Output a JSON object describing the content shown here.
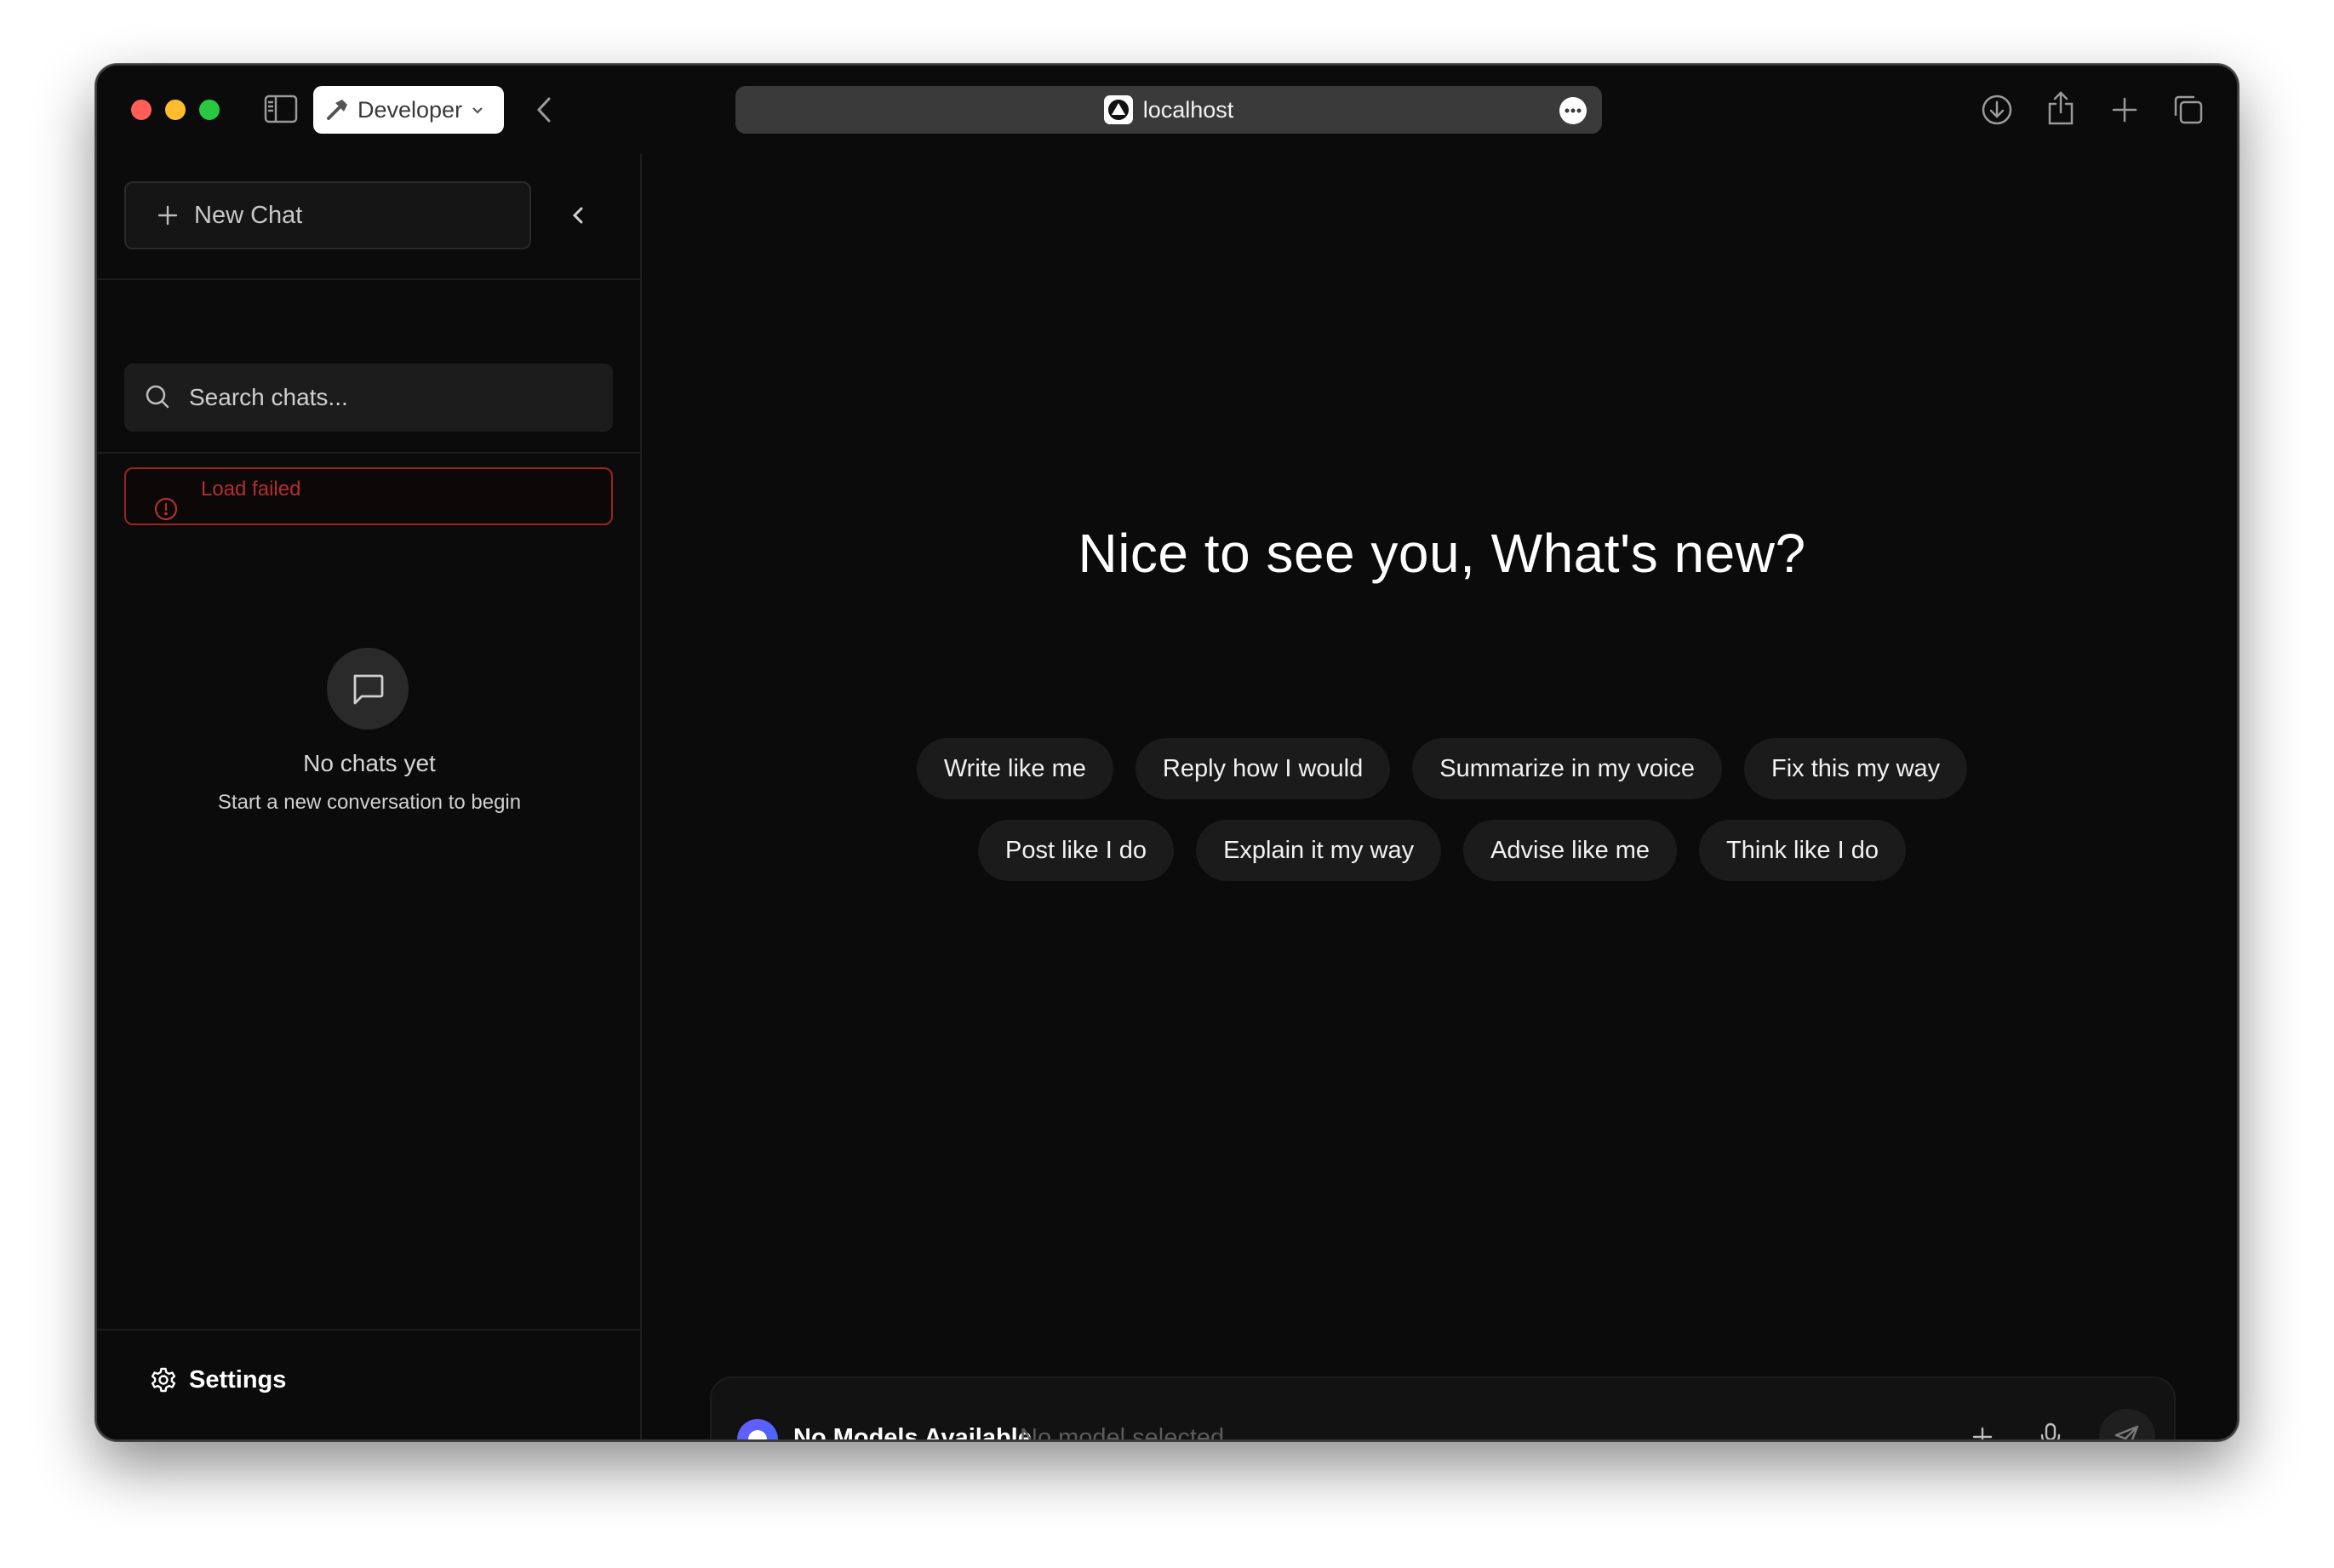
{
  "browser": {
    "profile_label": "Developer",
    "address": "localhost"
  },
  "sidebar": {
    "new_chat_label": "New Chat",
    "search_placeholder": "Search chats...",
    "error_text": "Load failed",
    "empty_title": "No chats yet",
    "empty_subtitle": "Start a new conversation to begin",
    "settings_label": "Settings"
  },
  "main": {
    "headline": "Nice to see you, What's new?",
    "suggestions_row1": [
      "Write like me",
      "Reply how I would",
      "Summarize in my voice",
      "Fix this my way"
    ],
    "suggestions_row2": [
      "Post like I do",
      "Explain it my way",
      "Advise like me",
      "Think like I do"
    ]
  },
  "composer": {
    "model_name": "No Models Available",
    "model_status": "No model selected"
  },
  "colors": {
    "background": "#0b0b0b",
    "error": "#b32e2e",
    "accent": "#5b63ff",
    "chip": "#1b1b1b"
  },
  "icons": {
    "sidebar_toggle": "sidebar-toggle-icon",
    "back": "chevron-left-icon",
    "download": "download-icon",
    "share": "share-icon",
    "new_tab": "plus-icon",
    "tabs": "tab-overview-icon",
    "search": "search-icon",
    "error": "alert-circle-icon",
    "empty_chats": "message-square-icon",
    "settings": "gear-icon",
    "attach": "plus-icon",
    "mic": "microphone-icon",
    "send": "send-icon"
  }
}
